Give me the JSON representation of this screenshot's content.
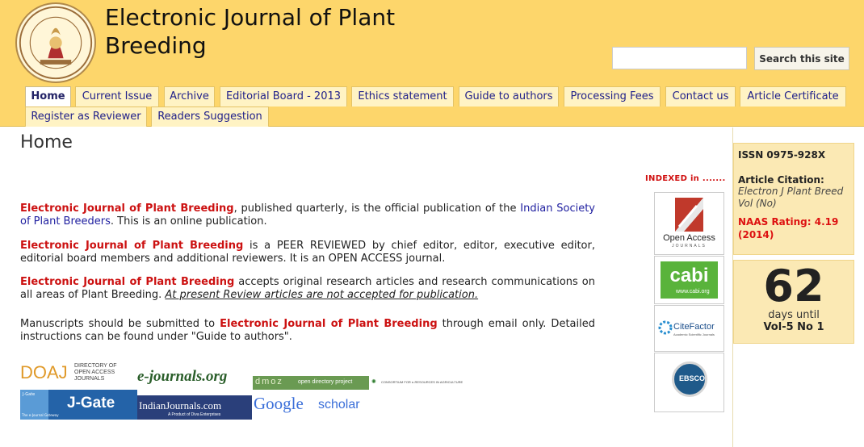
{
  "header": {
    "title_line1": "Electronic Journal of Plant",
    "title_line2": "Breeding",
    "logo_text": "INDIAN SOCIETY OF PLANT BREEDERS",
    "logo_estd": "ESTD 1993"
  },
  "search": {
    "value": "",
    "placeholder": "",
    "button_label": "Search this site"
  },
  "nav": {
    "tabs": [
      {
        "label": "Home",
        "active": true
      },
      {
        "label": "Current Issue"
      },
      {
        "label": "Archive"
      },
      {
        "label": "Editorial Board - 2013"
      },
      {
        "label": "Ethics statement"
      },
      {
        "label": "Guide to authors"
      },
      {
        "label": "Processing Fees"
      },
      {
        "label": "Contact us"
      },
      {
        "label": "Article Certificate"
      },
      {
        "label": "Register as Reviewer"
      },
      {
        "label": "Readers Suggestion"
      }
    ]
  },
  "main": {
    "page_title": "Home",
    "indexed_label": "INDEXED in .......",
    "journal_name": "Electronic Journal of Plant Breeding",
    "p1": {
      "a": ", published quarterly, is the official publication of the ",
      "link": "Indian Society of Plant Breeders",
      "b": ".  This is an online publication."
    },
    "p2": {
      "b": " is a PEER REVIEWED by chief editor, editor, executive editor, editorial board members and additional reviewers. It is an OPEN ACCESS journal."
    },
    "p3": {
      "b": " accepts original research articles and research communications on all areas of Plant Breeding. ",
      "note": "At present Review articles are not accepted for publication."
    },
    "p4": {
      "a": "Manuscripts should be submitted to ",
      "b": " through email only.  Detailed instructions can be found under \"Guide to authors\"."
    }
  },
  "indexed_logos": {
    "open_access": "Open Access",
    "open_access_sub": "JOURNALS",
    "cabi": "cabi",
    "cabi_url": "www.cabi.org",
    "citefactor": "CiteFactor",
    "citefactor_sub": "Academic Scientific Journals",
    "ebsco": "EBSCO"
  },
  "bottom_logos": {
    "doaj": "DOAJ",
    "doaj_sub1": "DIRECTORY OF",
    "doaj_sub2": "OPEN ACCESS",
    "doaj_sub3": "JOURNALS",
    "ejournals": "e-journals.org",
    "dmoz": "dmoz",
    "dmoz_sub": "open directory project",
    "cera": "CONSORTIUM FOR e-RESOURCES IN AGRICULTURE",
    "jgate": "J-Gate",
    "jgate_small": "J-Gate",
    "jgate_sub": "The e-Journal Gateway",
    "indianjournals": "IndianJournals.com",
    "indianjournals_sub": "A Product of Diva Enterprises",
    "google": "Google",
    "scholar": "scholar"
  },
  "sidebar": {
    "issn": "ISSN 0975-928X",
    "citation_label": "Article Citation:",
    "citation_value": "Electron J Plant Breed Vol (No)",
    "naas": "NAAS Rating: 4.19 (2014)",
    "countdown_number": "62",
    "countdown_unit": "days until",
    "countdown_target": "Vol-5 No 1"
  },
  "colors": {
    "header_bg": "#fdd66b",
    "journal_red": "#cc1111",
    "link_blue": "#2020a0",
    "sidebar_box": "#fbe9b4"
  }
}
